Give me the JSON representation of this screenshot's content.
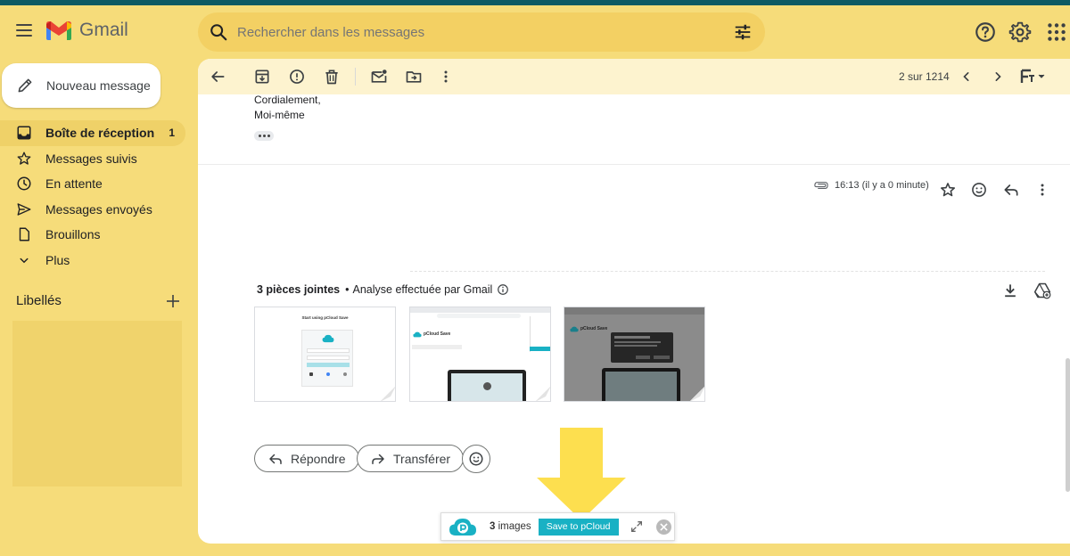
{
  "app": {
    "name": "Gmail"
  },
  "search": {
    "placeholder": "Rechercher dans les messages"
  },
  "compose": {
    "label": "Nouveau message"
  },
  "sidebar": {
    "items": [
      {
        "label": "Boîte de réception",
        "count": "1"
      },
      {
        "label": "Messages suivis"
      },
      {
        "label": "En attente"
      },
      {
        "label": "Messages envoyés"
      },
      {
        "label": "Brouillons"
      },
      {
        "label": "Plus"
      }
    ],
    "labels_title": "Libellés"
  },
  "toolbar": {
    "pager": "2 sur 1214"
  },
  "message": {
    "closing_line1": "Cordialement,",
    "closing_line2": "Moi-même",
    "time": "16:13 (il y a 0 minute)"
  },
  "attachments": {
    "count_label": "3 pièces jointes",
    "scan_label": "Analyse effectuée par Gmail",
    "thumb1_title": "Start using pCloud Save",
    "thumb2_title": "pCloud Save",
    "thumb3_title": "pCloud Save"
  },
  "actions": {
    "reply": "Répondre",
    "forward": "Transférer"
  },
  "pcloud": {
    "count": "3",
    "count_unit": "images",
    "save_label": "Save to pCloud"
  },
  "colors": {
    "background": "#f6dc7a",
    "accent": "#19b1c4",
    "arrow": "#fddf4f",
    "topstrip": "#0e5a63"
  }
}
